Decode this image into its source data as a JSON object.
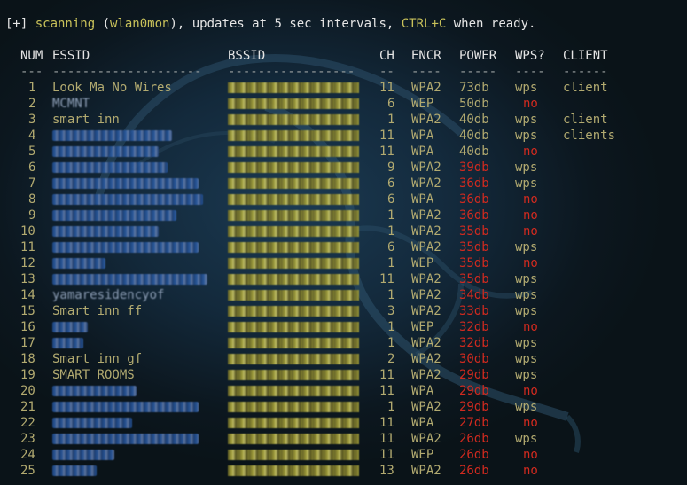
{
  "status_line": {
    "prefix": "[+] ",
    "scanning_label": "scanning",
    "open_paren": " (",
    "interface": "wlan0mon",
    "after_interface": "), updates at 5 sec intervals, ",
    "keys": "CTRL+C",
    "suffix": " when ready."
  },
  "table": {
    "headers": {
      "num": "NUM",
      "essid": "ESSID",
      "bssid": "BSSID",
      "ch": "CH",
      "encr": "ENCR",
      "power": "POWER",
      "wps": "WPS?",
      "client": "CLIENT"
    },
    "separators": {
      "num": "---",
      "essid": "--------------------",
      "bssid": "-----------------",
      "ch": "--",
      "encr": "----",
      "power": "-----",
      "wps": "----",
      "client": "------"
    },
    "rows": [
      {
        "num": "1",
        "essid": "Look Ma No Wires",
        "essid_hidden": false,
        "ch": "11",
        "encr": "WPA2",
        "power": "73db",
        "power_level": "strong",
        "wps": "wps",
        "client": "client"
      },
      {
        "num": "2",
        "essid": "MCMNT",
        "essid_hidden": false,
        "ch": "6",
        "encr": "WEP",
        "power": "50db",
        "power_level": "strong",
        "wps": "no",
        "client": ""
      },
      {
        "num": "3",
        "essid": "smart inn",
        "essid_hidden": false,
        "ch": "1",
        "encr": "WPA2",
        "power": "40db",
        "power_level": "strong",
        "wps": "wps",
        "client": "client"
      },
      {
        "num": "4",
        "essid": "",
        "essid_hidden": true,
        "ch": "11",
        "encr": "WPA",
        "power": "40db",
        "power_level": "strong",
        "wps": "wps",
        "client": "clients"
      },
      {
        "num": "5",
        "essid": "",
        "essid_hidden": true,
        "ch": "11",
        "encr": "WPA",
        "power": "40db",
        "power_level": "strong",
        "wps": "no",
        "client": ""
      },
      {
        "num": "6",
        "essid": "",
        "essid_hidden": true,
        "ch": "9",
        "encr": "WPA2",
        "power": "39db",
        "power_level": "weak",
        "wps": "wps",
        "client": ""
      },
      {
        "num": "7",
        "essid": "",
        "essid_hidden": true,
        "ch": "6",
        "encr": "WPA2",
        "power": "36db",
        "power_level": "weak",
        "wps": "wps",
        "client": ""
      },
      {
        "num": "8",
        "essid": "",
        "essid_hidden": true,
        "ch": "6",
        "encr": "WPA",
        "power": "36db",
        "power_level": "weak",
        "wps": "no",
        "client": ""
      },
      {
        "num": "9",
        "essid": "",
        "essid_hidden": true,
        "ch": "1",
        "encr": "WPA2",
        "power": "36db",
        "power_level": "weak",
        "wps": "no",
        "client": ""
      },
      {
        "num": "10",
        "essid": "",
        "essid_hidden": true,
        "ch": "1",
        "encr": "WPA2",
        "power": "35db",
        "power_level": "weak",
        "wps": "no",
        "client": ""
      },
      {
        "num": "11",
        "essid": "",
        "essid_hidden": true,
        "ch": "6",
        "encr": "WPA2",
        "power": "35db",
        "power_level": "weak",
        "wps": "wps",
        "client": ""
      },
      {
        "num": "12",
        "essid": "",
        "essid_hidden": true,
        "ch": "1",
        "encr": "WEP",
        "power": "35db",
        "power_level": "weak",
        "wps": "no",
        "client": ""
      },
      {
        "num": "13",
        "essid": "",
        "essid_hidden": true,
        "ch": "11",
        "encr": "WPA2",
        "power": "35db",
        "power_level": "weak",
        "wps": "wps",
        "client": ""
      },
      {
        "num": "14",
        "essid": "yamaresidencyof",
        "essid_hidden": false,
        "ch": "1",
        "encr": "WPA2",
        "power": "34db",
        "power_level": "weak",
        "wps": "wps",
        "client": ""
      },
      {
        "num": "15",
        "essid": "Smart inn ff",
        "essid_hidden": false,
        "ch": "3",
        "encr": "WPA2",
        "power": "33db",
        "power_level": "weak",
        "wps": "wps",
        "client": ""
      },
      {
        "num": "16",
        "essid": "",
        "essid_hidden": true,
        "ch": "1",
        "encr": "WEP",
        "power": "32db",
        "power_level": "weak",
        "wps": "no",
        "client": ""
      },
      {
        "num": "17",
        "essid": "",
        "essid_hidden": true,
        "ch": "1",
        "encr": "WPA2",
        "power": "32db",
        "power_level": "weak",
        "wps": "wps",
        "client": ""
      },
      {
        "num": "18",
        "essid": "Smart inn gf",
        "essid_hidden": false,
        "ch": "2",
        "encr": "WPA2",
        "power": "30db",
        "power_level": "weak",
        "wps": "wps",
        "client": ""
      },
      {
        "num": "19",
        "essid": "SMART ROOMS",
        "essid_hidden": false,
        "ch": "11",
        "encr": "WPA2",
        "power": "29db",
        "power_level": "weak",
        "wps": "wps",
        "client": ""
      },
      {
        "num": "20",
        "essid": "",
        "essid_hidden": true,
        "ch": "11",
        "encr": "WPA",
        "power": "29db",
        "power_level": "weak",
        "wps": "no",
        "client": ""
      },
      {
        "num": "21",
        "essid": "",
        "essid_hidden": true,
        "ch": "1",
        "encr": "WPA2",
        "power": "29db",
        "power_level": "weak",
        "wps": "wps",
        "client": ""
      },
      {
        "num": "22",
        "essid": "",
        "essid_hidden": true,
        "ch": "11",
        "encr": "WPA",
        "power": "27db",
        "power_level": "weak",
        "wps": "no",
        "client": ""
      },
      {
        "num": "23",
        "essid": "",
        "essid_hidden": true,
        "ch": "11",
        "encr": "WPA2",
        "power": "26db",
        "power_level": "weak",
        "wps": "wps",
        "client": ""
      },
      {
        "num": "24",
        "essid": "",
        "essid_hidden": true,
        "ch": "11",
        "encr": "WEP",
        "power": "26db",
        "power_level": "weak",
        "wps": "no",
        "client": ""
      },
      {
        "num": "25",
        "essid": "",
        "essid_hidden": true,
        "ch": "13",
        "encr": "WPA2",
        "power": "26db",
        "power_level": "weak",
        "wps": "no",
        "client": ""
      }
    ]
  },
  "colors": {
    "background": "#0b1419",
    "text_tan": "#b2aa70",
    "text_white": "#e6e6e6",
    "highlight_yellow": "#c9c25a",
    "alert_red": "#d12a1f"
  },
  "icons": {
    "background": "kali-dragon-logo"
  }
}
